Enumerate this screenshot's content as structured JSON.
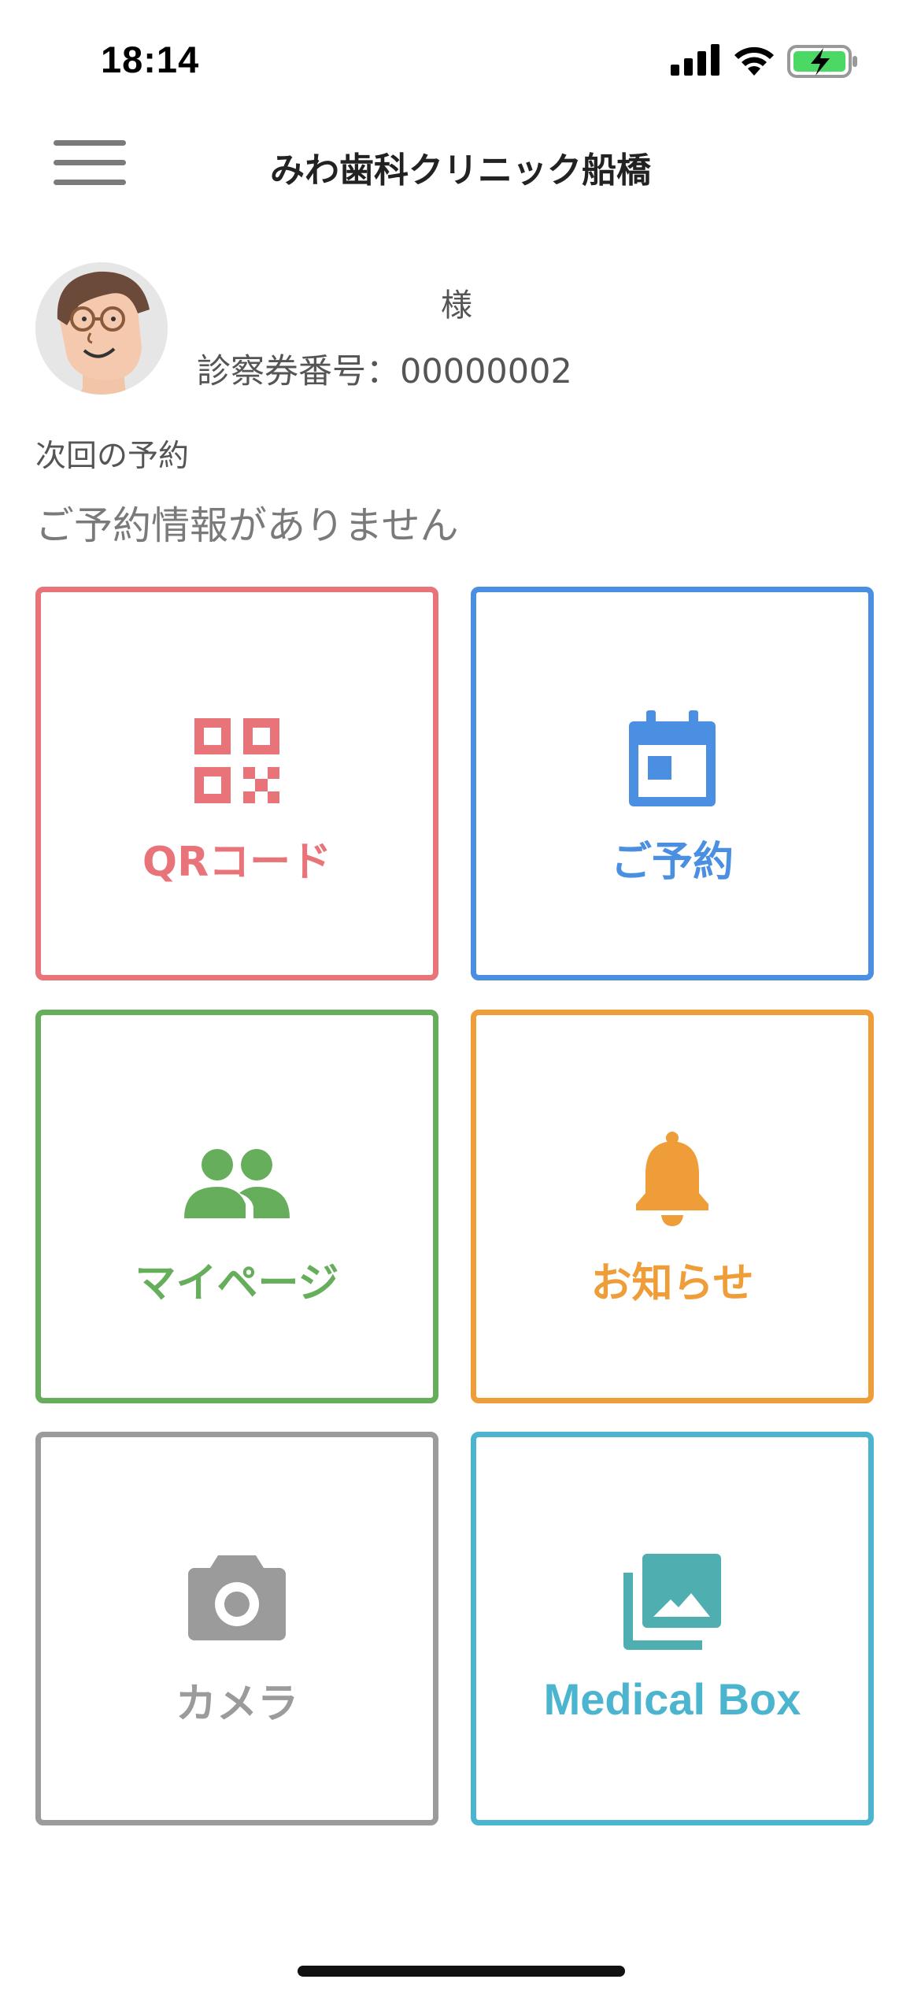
{
  "status_bar": {
    "time": "18:14"
  },
  "nav": {
    "title": "みわ歯科クリニック船橋"
  },
  "profile": {
    "honorific": "様",
    "card_number": "診察券番号：00000002"
  },
  "next_appointment": {
    "label": "次回の予約",
    "value": "ご予約情報がありません"
  },
  "tiles": [
    {
      "label": "QRコード",
      "icon": "qr-code-icon",
      "color": "#E8747A"
    },
    {
      "label": "ご予約",
      "icon": "calendar-icon",
      "color": "#4A8FE2"
    },
    {
      "label": "マイページ",
      "icon": "people-icon",
      "color": "#66AE5C"
    },
    {
      "label": "お知らせ",
      "icon": "bell-icon",
      "color": "#EF9D38"
    },
    {
      "label": "カメラ",
      "icon": "camera-icon",
      "color": "#9B9B9B"
    },
    {
      "label": "Medical Box",
      "icon": "photo-library-icon",
      "color": "#4BB5CF"
    }
  ]
}
